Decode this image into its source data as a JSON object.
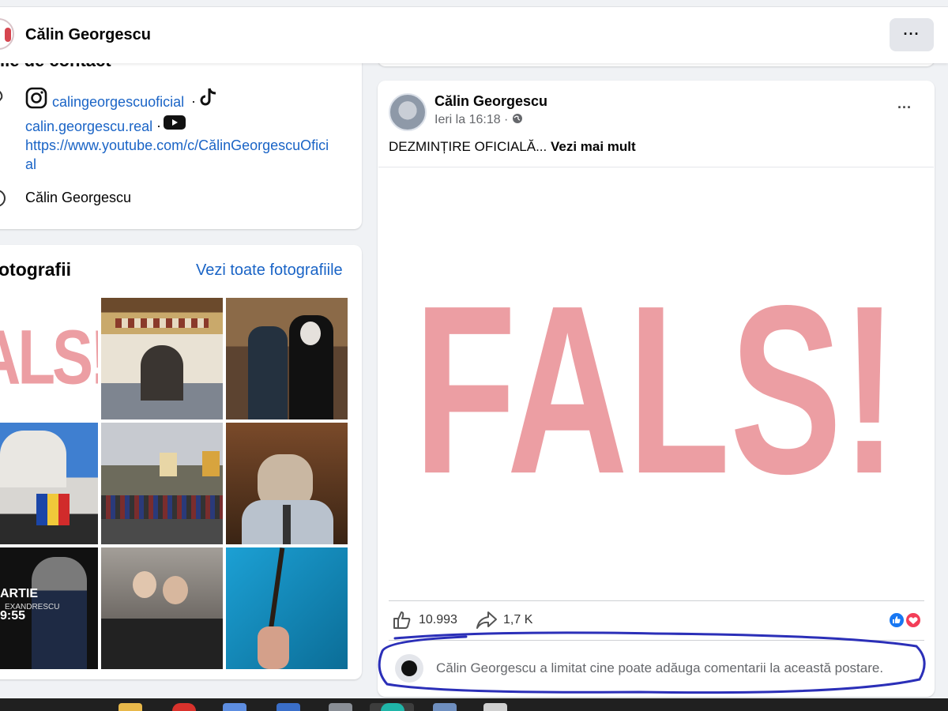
{
  "header": {
    "page_name": "Călin Georgescu",
    "more_label": "···"
  },
  "contact": {
    "section_title": "ile de contact",
    "instagram_handle": "calingeorgescuoficial",
    "separator": "·",
    "tiktok_handle": "calin.georgescu.real",
    "youtube_url": "https://www.youtube.com/c/CălinGeorgescuOfici",
    "youtube_url_cont": "al",
    "name": "Călin Georgescu"
  },
  "photos": {
    "title": "otografii",
    "see_all": "Vezi toate fotografiile",
    "first_photo_text": "ALS!",
    "last_row_text_1": "ARTIE",
    "last_row_text_2": "EXANDRESCU",
    "last_row_text_3": "9:55"
  },
  "post": {
    "author": "Călin Georgescu",
    "time": "Ieri la 16:18 ·",
    "text": "DEZMINȚIRE OFICIALĂ...",
    "see_more": "Vezi mai mult",
    "image_text": "FALS!",
    "likes": "10.993",
    "shares": "1,7 K",
    "comment_notice": "Călin Georgescu a limitat cine poate adăuga comentarii la această postare."
  },
  "colors": {
    "link": "#1a64c6",
    "fals_pink": "#ec9ea3",
    "annotation_blue": "#2b2fb8"
  }
}
